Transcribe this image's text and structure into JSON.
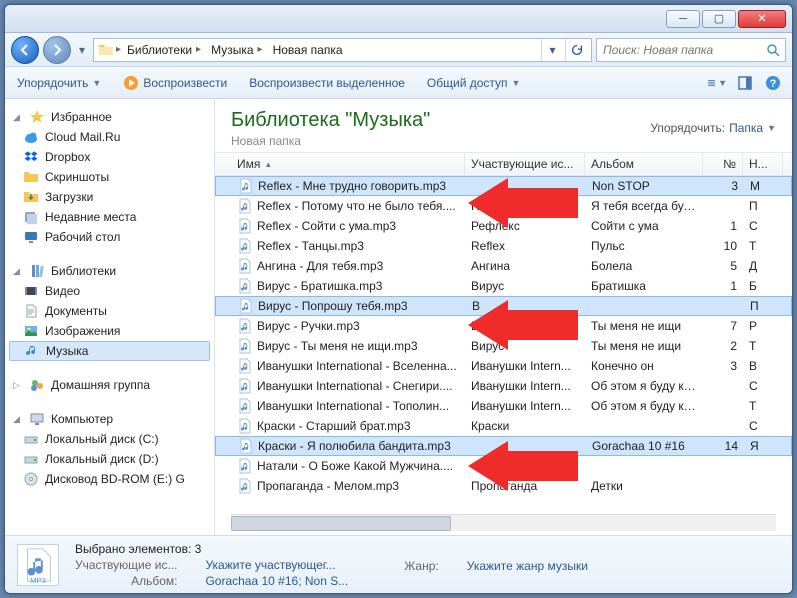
{
  "breadcrumbs": [
    "Библиотеки",
    "Музыка",
    "Новая папка"
  ],
  "search": {
    "placeholder": "Поиск: Новая папка"
  },
  "toolbar": {
    "organize": "Упорядочить",
    "play": "Воспроизвести",
    "play_selected": "Воспроизвести выделенное",
    "share": "Общий доступ"
  },
  "library": {
    "title": "Библиотека \"Музыка\"",
    "subtitle": "Новая папка",
    "sort_label": "Упорядочить:",
    "sort_value": "Папка"
  },
  "columns": {
    "name": "Имя",
    "artist": "Участвующие ис...",
    "album": "Альбом",
    "track": "№",
    "title": "Н..."
  },
  "sidebar": {
    "favorites": "Избранное",
    "fav_items": [
      "Cloud Mail.Ru",
      "Dropbox",
      "Скриншоты",
      "Загрузки",
      "Недавние места",
      "Рабочий стол"
    ],
    "libraries": "Библиотеки",
    "lib_items": [
      "Видео",
      "Документы",
      "Изображения",
      "Музыка"
    ],
    "homegroup": "Домашняя группа",
    "computer": "Компьютер",
    "comp_items": [
      "Локальный диск (C:)",
      "Локальный диск (D:)",
      "Дисковод BD-ROM (E:) G"
    ]
  },
  "files": [
    {
      "name": "Reflex - Мне трудно говорить.mp3",
      "artist": "",
      "album": "Non STOP",
      "track": "3",
      "title": "M",
      "sel": true
    },
    {
      "name": "Reflex - Потому что не было тебя....",
      "artist": "Refle",
      "album": "Я тебя всегда буду ...",
      "track": "",
      "title": "П"
    },
    {
      "name": "Reflex - Сойти с ума.mp3",
      "artist": "Рефлекс",
      "album": "Сойти с ума",
      "track": "1",
      "title": "С"
    },
    {
      "name": "Reflex - Танцы.mp3",
      "artist": "Reflex",
      "album": "Пульс",
      "track": "10",
      "title": "Т"
    },
    {
      "name": "Ангина - Для тебя.mp3",
      "artist": "Ангина",
      "album": "Болела",
      "track": "5",
      "title": "Д"
    },
    {
      "name": "Вирус - Братишка.mp3",
      "artist": "Вирус",
      "album": "Братишка",
      "track": "1",
      "title": "Б"
    },
    {
      "name": "Вирус - Попрошу тебя.mp3",
      "artist": "В",
      "album": "",
      "track": "",
      "title": "П",
      "sel": true
    },
    {
      "name": "Вирус - Ручки.mp3",
      "artist": "В",
      "album": "Ты меня не ищи",
      "track": "7",
      "title": "Р"
    },
    {
      "name": "Вирус - Ты меня не ищи.mp3",
      "artist": "Вирус",
      "album": "Ты меня не ищи",
      "track": "2",
      "title": "Т"
    },
    {
      "name": "Иванушки International - Вселенна...",
      "artist": "Иванушки Intern...",
      "album": "Конечно он",
      "track": "3",
      "title": "В"
    },
    {
      "name": "Иванушки International - Снегири....",
      "artist": "Иванушки Intern...",
      "album": "Об этом я буду кр...",
      "track": "",
      "title": "С"
    },
    {
      "name": "Иванушки International - Тополин...",
      "artist": "Иванушки Intern...",
      "album": "Об этом я буду кр...",
      "track": "",
      "title": "Т"
    },
    {
      "name": "Краски - Старший брат.mp3",
      "artist": "Краски",
      "album": "",
      "track": "",
      "title": "С"
    },
    {
      "name": "Краски - Я полюбила бандита.mp3",
      "artist": "",
      "album": "Gorachaa 10 #16",
      "track": "14",
      "title": "Я",
      "sel": true
    },
    {
      "name": "Натали - О Боже Какой Мужчина....",
      "artist": "",
      "album": "",
      "track": "",
      "title": ""
    },
    {
      "name": "Пропаганда - Мелом.mp3",
      "artist": "Пропаганда",
      "album": "Детки",
      "track": "",
      "title": ""
    }
  ],
  "status": {
    "selection": "Выбрано элементов: 3",
    "artist_label": "Участвующие ис...",
    "artist_value": "Укажите участвующег...",
    "album_label": "Альбом:",
    "album_value": "Gorachaa 10 #16; Non S...",
    "genre_label": "Жанр:",
    "genre_value": "Укажите жанр музыки",
    "thumb_text": "MP3"
  },
  "icons": {
    "star": "star-icon",
    "cloud": "cloud-icon",
    "dropbox": "dropbox-icon",
    "folder": "folder-icon",
    "download": "download-icon",
    "recent": "recent-icon",
    "desktop": "desktop-icon",
    "library": "library-icon",
    "video": "video-icon",
    "document": "document-icon",
    "image": "image-icon",
    "music": "music-icon",
    "homegroup": "homegroup-icon",
    "computer": "computer-icon",
    "drive": "drive-icon",
    "disc": "disc-icon",
    "play": "play-icon",
    "mp3": "mp3-icon"
  }
}
